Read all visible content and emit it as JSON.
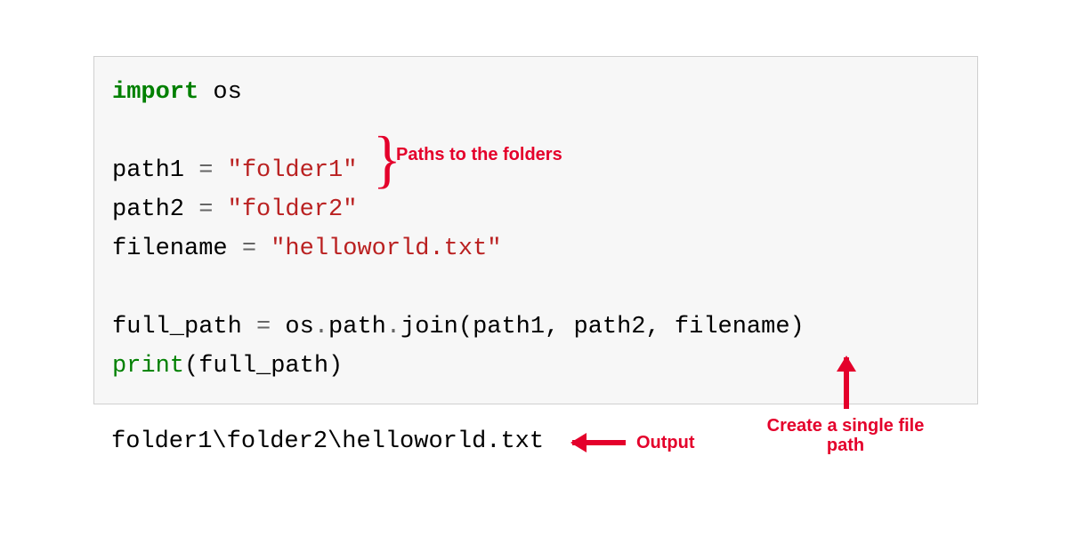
{
  "code": {
    "line1_kw": "import",
    "line1_mod": " os",
    "line3_a": "path1 ",
    "line3_op": "=",
    "line3_b": " ",
    "line3_str": "\"folder1\"",
    "line4_a": "path2 ",
    "line4_op": "=",
    "line4_b": " ",
    "line4_str": "\"folder2\"",
    "line5_a": "filename ",
    "line5_op": "=",
    "line5_b": " ",
    "line5_str": "\"helloworld.txt\"",
    "line7_a": "full_path ",
    "line7_op": "=",
    "line7_b": " os",
    "line7_dot1": ".",
    "line7_c": "path",
    "line7_dot2": ".",
    "line7_d": "join(path1, path2, filename)",
    "line8_fn": "print",
    "line8_rest": "(full_path)"
  },
  "output": "folder1\\folder2\\helloworld.txt",
  "annotations": {
    "paths": "Paths to the folders",
    "output": "Output",
    "create": "Create a single file path"
  },
  "colors": {
    "annotation": "#e4002b",
    "keyword": "#008000",
    "string": "#ba2121",
    "operator": "#666666",
    "code_bg": "#f7f7f7",
    "border": "#cfcfcf"
  }
}
